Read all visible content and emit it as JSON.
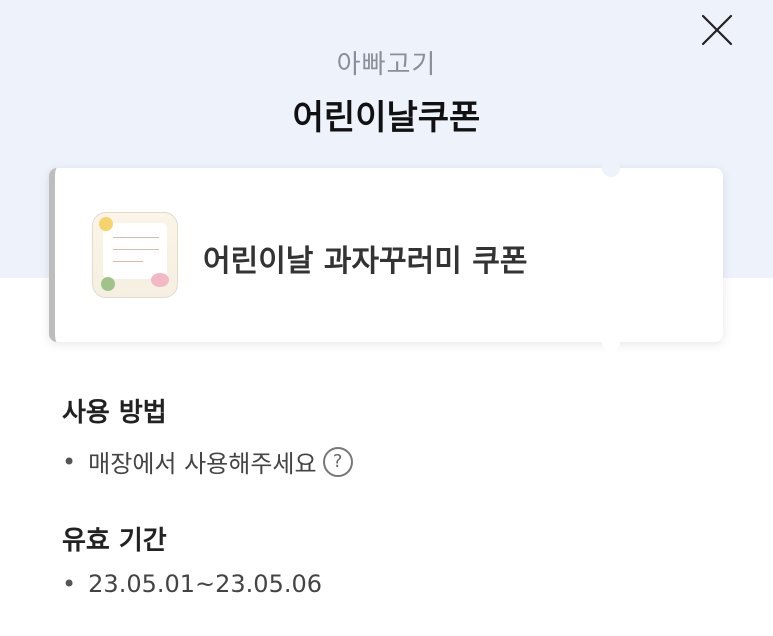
{
  "header": {
    "store_name": "아빠고기",
    "title": "어린이날쿠폰",
    "close_icon": "close-icon"
  },
  "coupon": {
    "name": "어린이날 과자꾸러미 쿠폰",
    "thumbnail_icon": "coupon-image"
  },
  "usage": {
    "title": "사용 방법",
    "bullet": "•",
    "text": "매장에서 사용해주세요",
    "help_icon_glyph": "?"
  },
  "validity": {
    "title": "유효 기간",
    "bullet": "•",
    "text": "23.05.01~23.05.06"
  },
  "colors": {
    "top_band": "#edf2fb",
    "ticket_accent": "#bdbdbd",
    "title_text": "#111111"
  }
}
